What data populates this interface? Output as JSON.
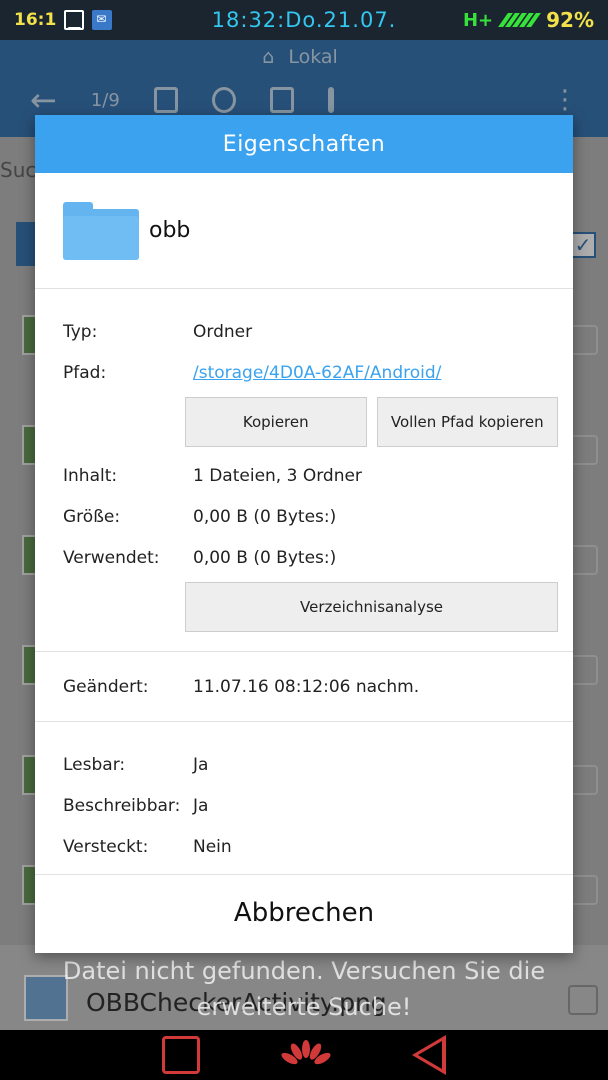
{
  "status_bar": {
    "notif_count": "16:1",
    "time": "18:32:Do.21.07.",
    "network": "H+",
    "battery": "92%"
  },
  "background": {
    "tab_label": "Lokal",
    "selection_count": "1/9",
    "search_hint": "Suc",
    "file_name": "OBBCheckerActivity.png",
    "toast": "Datei nicht gefunden. Versuchen Sie die erweiterte Suche!"
  },
  "dialog": {
    "title": "Eigenschaften",
    "item_name": "obb",
    "info": {
      "type_label": "Typ:",
      "type_value": "Ordner",
      "path_label": "Pfad:",
      "path_value": "/storage/4D0A-62AF/Android/",
      "copy_button": "Kopieren",
      "copy_full_path_button": "Vollen Pfad kopieren",
      "content_label": "Inhalt:",
      "content_value": "1 Dateien, 3 Ordner",
      "size_label": "Größe:",
      "size_value": "0,00 B (0 Bytes:)",
      "used_label": "Verwendet:",
      "used_value": "0,00 B (0 Bytes:)",
      "analyze_button": "Verzeichnisanalyse"
    },
    "modified": {
      "label": "Geändert:",
      "value": "11.07.16 08:12:06 nachm."
    },
    "flags": {
      "readable_label": "Lesbar:",
      "readable_value": "Ja",
      "writable_label": "Beschreibbar:",
      "writable_value": "Ja",
      "hidden_label": "Versteckt:",
      "hidden_value": "Nein"
    },
    "cancel_button": "Abbrechen"
  },
  "colors": {
    "accent": "#3aa2ef",
    "appbar": "#3a77b3",
    "nav_red": "#d23a3a"
  }
}
